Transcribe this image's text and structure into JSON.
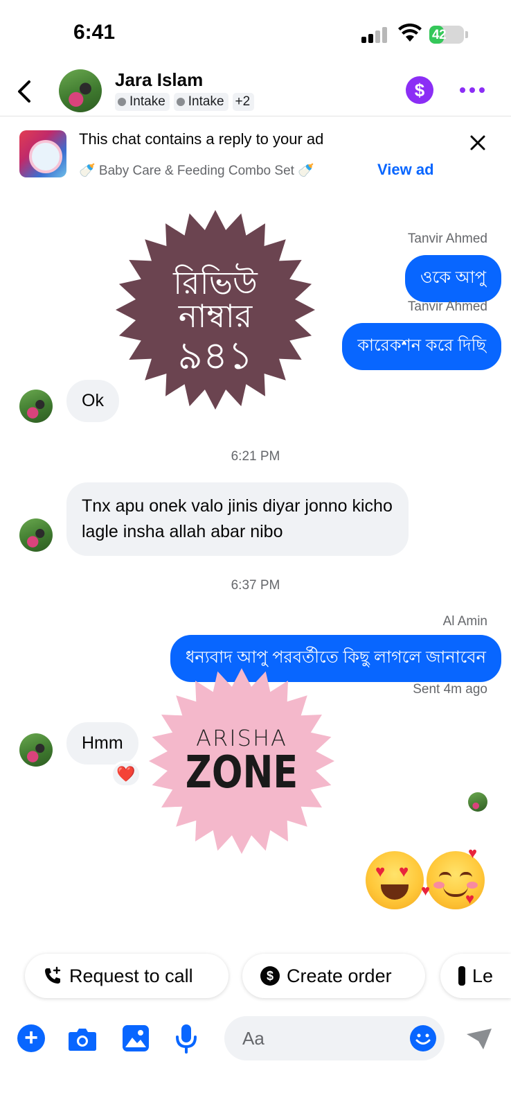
{
  "status_bar": {
    "time": "6:41",
    "battery": "42",
    "battery_level": 0.42
  },
  "header": {
    "contact_name": "Jara Islam",
    "labels": [
      "Intake",
      "Intake"
    ],
    "labels_more": "+2",
    "icons": [
      "back-icon",
      "dollar-icon",
      "more-icon"
    ]
  },
  "ad_banner": {
    "title": "This chat contains a reply to your ad",
    "product": "🍼 Baby Care & Feeding Combo Set 🍼",
    "view_label": "View ad"
  },
  "stickers": {
    "review": {
      "line1": "রিভিউ",
      "line2": "নাম্বার",
      "line3": "৯৪১",
      "color": "#6b4450"
    },
    "brand": {
      "line1": "ARISHA",
      "line2": "ZONE",
      "color": "#f4b8cb"
    }
  },
  "messages": [
    {
      "sender": "Tanvir Ahmed",
      "text": "ওকে আপু",
      "direction": "out"
    },
    {
      "sender": "Tanvir Ahmed",
      "text": "কারেকশন করে দিছি",
      "direction": "out"
    },
    {
      "text": "Ok",
      "direction": "in"
    },
    {
      "timestamp": "6:21 PM"
    },
    {
      "text": "Tnx apu onek valo jinis diyar jonno kicho lagle insha allah abar nibo",
      "direction": "in"
    },
    {
      "timestamp": "6:37 PM"
    },
    {
      "sender": "Al Amin",
      "text": "ধন্যবাদ আপু পরবর্তীতে কিছু লাগলে জানাবেন",
      "direction": "out",
      "status": "Sent 4m ago"
    },
    {
      "text": "Hmm",
      "direction": "in",
      "reaction": "❤️"
    },
    {
      "emojis": [
        "😍",
        "🥰"
      ],
      "direction": "out"
    }
  ],
  "quick_actions": [
    "Request to call",
    "Create order",
    "Le"
  ],
  "composer": {
    "placeholder": "Aa"
  },
  "colors": {
    "accent": "#0866ff",
    "brand_purple": "#8b2ef5",
    "bubble_in": "#f0f2f5"
  }
}
